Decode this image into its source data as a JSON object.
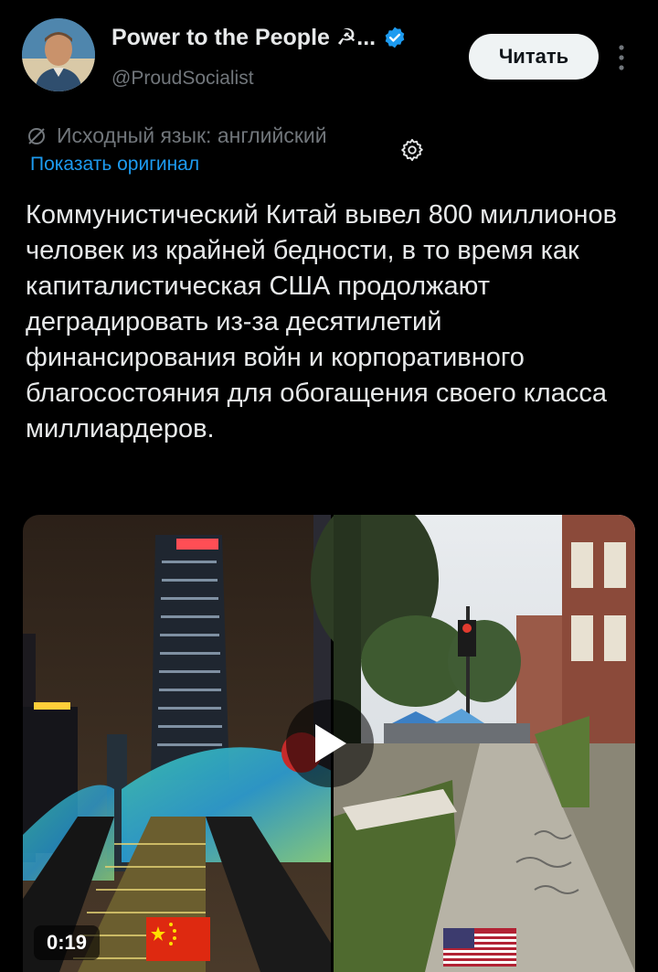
{
  "author": {
    "display_name": "Power to the People ☭...",
    "handle": "@ProudSocialist",
    "verified": true,
    "verified_color": "#1d9bf0"
  },
  "follow_button": {
    "label": "Читать"
  },
  "translation": {
    "notice": "Исходный язык: английский",
    "show_original": "Показать оригинал"
  },
  "tweet": {
    "text": "Коммунистический Китай вывел 800 миллионов человек из крайней бедности, в то время как капиталистическая США продолжают деградировать из-за десятилетий финансирования войн и корпоративного благосостояния для обогащения своего класса миллиардеров."
  },
  "media": {
    "duration": "0:19",
    "left_flag": "china-flag-icon",
    "right_flag": "us-flag-icon"
  },
  "colors": {
    "background": "#000000",
    "link": "#1d9bf0",
    "secondary_text": "#71767b"
  }
}
